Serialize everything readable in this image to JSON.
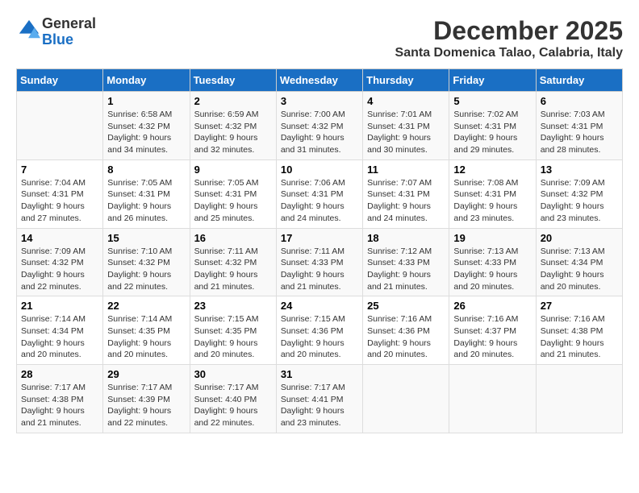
{
  "logo": {
    "general": "General",
    "blue": "Blue"
  },
  "title": "December 2025",
  "subtitle": "Santa Domenica Talao, Calabria, Italy",
  "days_of_week": [
    "Sunday",
    "Monday",
    "Tuesday",
    "Wednesday",
    "Thursday",
    "Friday",
    "Saturday"
  ],
  "weeks": [
    [
      {
        "day": "",
        "sunrise": "",
        "sunset": "",
        "daylight": ""
      },
      {
        "day": "1",
        "sunrise": "Sunrise: 6:58 AM",
        "sunset": "Sunset: 4:32 PM",
        "daylight": "Daylight: 9 hours and 34 minutes."
      },
      {
        "day": "2",
        "sunrise": "Sunrise: 6:59 AM",
        "sunset": "Sunset: 4:32 PM",
        "daylight": "Daylight: 9 hours and 32 minutes."
      },
      {
        "day": "3",
        "sunrise": "Sunrise: 7:00 AM",
        "sunset": "Sunset: 4:32 PM",
        "daylight": "Daylight: 9 hours and 31 minutes."
      },
      {
        "day": "4",
        "sunrise": "Sunrise: 7:01 AM",
        "sunset": "Sunset: 4:31 PM",
        "daylight": "Daylight: 9 hours and 30 minutes."
      },
      {
        "day": "5",
        "sunrise": "Sunrise: 7:02 AM",
        "sunset": "Sunset: 4:31 PM",
        "daylight": "Daylight: 9 hours and 29 minutes."
      },
      {
        "day": "6",
        "sunrise": "Sunrise: 7:03 AM",
        "sunset": "Sunset: 4:31 PM",
        "daylight": "Daylight: 9 hours and 28 minutes."
      }
    ],
    [
      {
        "day": "7",
        "sunrise": "Sunrise: 7:04 AM",
        "sunset": "Sunset: 4:31 PM",
        "daylight": "Daylight: 9 hours and 27 minutes."
      },
      {
        "day": "8",
        "sunrise": "Sunrise: 7:05 AM",
        "sunset": "Sunset: 4:31 PM",
        "daylight": "Daylight: 9 hours and 26 minutes."
      },
      {
        "day": "9",
        "sunrise": "Sunrise: 7:05 AM",
        "sunset": "Sunset: 4:31 PM",
        "daylight": "Daylight: 9 hours and 25 minutes."
      },
      {
        "day": "10",
        "sunrise": "Sunrise: 7:06 AM",
        "sunset": "Sunset: 4:31 PM",
        "daylight": "Daylight: 9 hours and 24 minutes."
      },
      {
        "day": "11",
        "sunrise": "Sunrise: 7:07 AM",
        "sunset": "Sunset: 4:31 PM",
        "daylight": "Daylight: 9 hours and 24 minutes."
      },
      {
        "day": "12",
        "sunrise": "Sunrise: 7:08 AM",
        "sunset": "Sunset: 4:31 PM",
        "daylight": "Daylight: 9 hours and 23 minutes."
      },
      {
        "day": "13",
        "sunrise": "Sunrise: 7:09 AM",
        "sunset": "Sunset: 4:32 PM",
        "daylight": "Daylight: 9 hours and 23 minutes."
      }
    ],
    [
      {
        "day": "14",
        "sunrise": "Sunrise: 7:09 AM",
        "sunset": "Sunset: 4:32 PM",
        "daylight": "Daylight: 9 hours and 22 minutes."
      },
      {
        "day": "15",
        "sunrise": "Sunrise: 7:10 AM",
        "sunset": "Sunset: 4:32 PM",
        "daylight": "Daylight: 9 hours and 22 minutes."
      },
      {
        "day": "16",
        "sunrise": "Sunrise: 7:11 AM",
        "sunset": "Sunset: 4:32 PM",
        "daylight": "Daylight: 9 hours and 21 minutes."
      },
      {
        "day": "17",
        "sunrise": "Sunrise: 7:11 AM",
        "sunset": "Sunset: 4:33 PM",
        "daylight": "Daylight: 9 hours and 21 minutes."
      },
      {
        "day": "18",
        "sunrise": "Sunrise: 7:12 AM",
        "sunset": "Sunset: 4:33 PM",
        "daylight": "Daylight: 9 hours and 21 minutes."
      },
      {
        "day": "19",
        "sunrise": "Sunrise: 7:13 AM",
        "sunset": "Sunset: 4:33 PM",
        "daylight": "Daylight: 9 hours and 20 minutes."
      },
      {
        "day": "20",
        "sunrise": "Sunrise: 7:13 AM",
        "sunset": "Sunset: 4:34 PM",
        "daylight": "Daylight: 9 hours and 20 minutes."
      }
    ],
    [
      {
        "day": "21",
        "sunrise": "Sunrise: 7:14 AM",
        "sunset": "Sunset: 4:34 PM",
        "daylight": "Daylight: 9 hours and 20 minutes."
      },
      {
        "day": "22",
        "sunrise": "Sunrise: 7:14 AM",
        "sunset": "Sunset: 4:35 PM",
        "daylight": "Daylight: 9 hours and 20 minutes."
      },
      {
        "day": "23",
        "sunrise": "Sunrise: 7:15 AM",
        "sunset": "Sunset: 4:35 PM",
        "daylight": "Daylight: 9 hours and 20 minutes."
      },
      {
        "day": "24",
        "sunrise": "Sunrise: 7:15 AM",
        "sunset": "Sunset: 4:36 PM",
        "daylight": "Daylight: 9 hours and 20 minutes."
      },
      {
        "day": "25",
        "sunrise": "Sunrise: 7:16 AM",
        "sunset": "Sunset: 4:36 PM",
        "daylight": "Daylight: 9 hours and 20 minutes."
      },
      {
        "day": "26",
        "sunrise": "Sunrise: 7:16 AM",
        "sunset": "Sunset: 4:37 PM",
        "daylight": "Daylight: 9 hours and 20 minutes."
      },
      {
        "day": "27",
        "sunrise": "Sunrise: 7:16 AM",
        "sunset": "Sunset: 4:38 PM",
        "daylight": "Daylight: 9 hours and 21 minutes."
      }
    ],
    [
      {
        "day": "28",
        "sunrise": "Sunrise: 7:17 AM",
        "sunset": "Sunset: 4:38 PM",
        "daylight": "Daylight: 9 hours and 21 minutes."
      },
      {
        "day": "29",
        "sunrise": "Sunrise: 7:17 AM",
        "sunset": "Sunset: 4:39 PM",
        "daylight": "Daylight: 9 hours and 22 minutes."
      },
      {
        "day": "30",
        "sunrise": "Sunrise: 7:17 AM",
        "sunset": "Sunset: 4:40 PM",
        "daylight": "Daylight: 9 hours and 22 minutes."
      },
      {
        "day": "31",
        "sunrise": "Sunrise: 7:17 AM",
        "sunset": "Sunset: 4:41 PM",
        "daylight": "Daylight: 9 hours and 23 minutes."
      },
      {
        "day": "",
        "sunrise": "",
        "sunset": "",
        "daylight": ""
      },
      {
        "day": "",
        "sunrise": "",
        "sunset": "",
        "daylight": ""
      },
      {
        "day": "",
        "sunrise": "",
        "sunset": "",
        "daylight": ""
      }
    ]
  ]
}
